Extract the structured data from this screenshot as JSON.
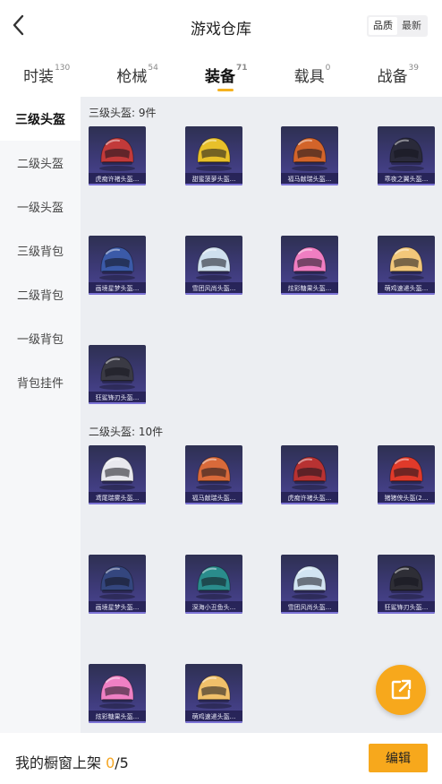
{
  "header": {
    "title": "游戏仓库",
    "sort_options": [
      "品质",
      "最新"
    ]
  },
  "tabs": [
    {
      "label": "时装",
      "count": "130"
    },
    {
      "label": "枪械",
      "count": "54"
    },
    {
      "label": "装备",
      "count": "71"
    },
    {
      "label": "载具",
      "count": "0"
    },
    {
      "label": "战备",
      "count": "39"
    }
  ],
  "sidebar": [
    "三级头盔",
    "二级头盔",
    "一级头盔",
    "三级背包",
    "二级背包",
    "一级背包",
    "背包挂件"
  ],
  "sections": [
    {
      "title": "三级头盔: 9件",
      "items": [
        {
          "name": "虎痴许褚头盔...",
          "color": "#c23a3a",
          "icon": "tiger-helmet"
        },
        {
          "name": "甜蜜菠萝头盔...",
          "color": "#e8c02a",
          "icon": "pineapple-helmet"
        },
        {
          "name": "福马献瑞头盔...",
          "color": "#d2642a",
          "icon": "horse-helmet"
        },
        {
          "name": "乖夜之翼头盔...",
          "color": "#2a2a3a",
          "icon": "dark-wing-helmet"
        },
        {
          "name": "画境星梦头盔...",
          "color": "#3b5aa8",
          "icon": "starry-helmet"
        },
        {
          "name": "雪团风尚头盔...",
          "color": "#cfe0ee",
          "icon": "snowball-helmet"
        },
        {
          "name": "炫彩糖果头盔...",
          "color": "#f07ec2",
          "icon": "candy-helmet"
        },
        {
          "name": "萌鸡速递头盔...",
          "color": "#f2c77a",
          "icon": "chick-helmet"
        },
        {
          "name": "狂鲨锋刃头盔...",
          "color": "#3a3a44",
          "icon": "shark-helmet"
        }
      ]
    },
    {
      "title": "二级头盔: 10件",
      "items": [
        {
          "name": "鸢尾瑞雾头盔...",
          "color": "#e8e8ee",
          "icon": "iris-helmet"
        },
        {
          "name": "福马献瑞头盔...",
          "color": "#d96a3a",
          "icon": "horse-helmet"
        },
        {
          "name": "虎痴许褚头盔...",
          "color": "#b83232",
          "icon": "tiger-helmet"
        },
        {
          "name": "猪猪侠头盔(2...",
          "color": "#e03a2a",
          "icon": "pig-helmet"
        },
        {
          "name": "画境星梦头盔...",
          "color": "#34467e",
          "icon": "starry-helmet"
        },
        {
          "name": "深海小丑鱼头...",
          "color": "#2a8c8c",
          "icon": "clownfish-helmet"
        },
        {
          "name": "雪团风尚头盔...",
          "color": "#d2e4f2",
          "icon": "snowball-helmet"
        },
        {
          "name": "狂鲨锋刃头盔...",
          "color": "#2e2e36",
          "icon": "shark-helmet"
        },
        {
          "name": "炫彩糖果头盔...",
          "color": "#ef80c4",
          "icon": "candy-helmet"
        },
        {
          "name": "萌鸡速递头盔...",
          "color": "#f0c06a",
          "icon": "chick-helmet"
        }
      ]
    }
  ],
  "bottom": {
    "prefix": "我的橱窗上架 ",
    "current": "0",
    "total": "/5",
    "edit_label": "编辑"
  },
  "colors": {
    "accent": "#f7a81c"
  }
}
